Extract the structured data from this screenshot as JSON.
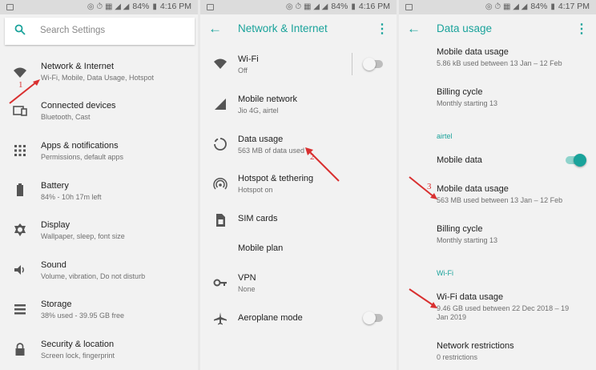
{
  "status": {
    "p1_battery": "84%",
    "p1_time": "4:16 PM",
    "p2_battery": "84%",
    "p2_time": "4:16 PM",
    "p3_battery": "84%",
    "p3_time": "4:17 PM"
  },
  "panel1": {
    "search_placeholder": "Search Settings",
    "items": [
      {
        "title": "Network & Internet",
        "subtitle": "Wi-Fi, Mobile, Data Usage, Hotspot",
        "icon": "wifi-icon"
      },
      {
        "title": "Connected devices",
        "subtitle": "Bluetooth, Cast",
        "icon": "devices-icon"
      },
      {
        "title": "Apps & notifications",
        "subtitle": "Permissions, default apps",
        "icon": "apps-grid-icon"
      },
      {
        "title": "Battery",
        "subtitle": "84% - 10h 17m left",
        "icon": "battery-icon"
      },
      {
        "title": "Display",
        "subtitle": "Wallpaper, sleep, font size",
        "icon": "brightness-icon"
      },
      {
        "title": "Sound",
        "subtitle": "Volume, vibration, Do not disturb",
        "icon": "volume-icon"
      },
      {
        "title": "Storage",
        "subtitle": "38% used - 39.95 GB free",
        "icon": "storage-icon"
      },
      {
        "title": "Security & location",
        "subtitle": "Screen lock, fingerprint",
        "icon": "lock-icon"
      }
    ]
  },
  "panel2": {
    "title": "Network & Internet",
    "items": [
      {
        "title": "Wi-Fi",
        "subtitle": "Off",
        "icon": "wifi-icon"
      },
      {
        "title": "Mobile network",
        "subtitle": "Jio 4G, airtel",
        "icon": "signal-icon"
      },
      {
        "title": "Data usage",
        "subtitle": "563 MB of data used",
        "icon": "data-usage-icon"
      },
      {
        "title": "Hotspot & tethering",
        "subtitle": "Hotspot on",
        "icon": "hotspot-icon"
      },
      {
        "title": "SIM cards",
        "subtitle": "",
        "icon": "sim-card-icon"
      },
      {
        "title": "Mobile plan",
        "subtitle": "",
        "icon": ""
      },
      {
        "title": "VPN",
        "subtitle": "None",
        "icon": "vpn-key-icon"
      },
      {
        "title": "Aeroplane mode",
        "subtitle": "",
        "icon": "airplane-icon"
      }
    ]
  },
  "panel3": {
    "title": "Data usage",
    "items": [
      {
        "title": "Mobile data usage",
        "subtitle": "5.86 kB used between 13 Jan – 12 Feb"
      },
      {
        "title": "Billing cycle",
        "subtitle": "Monthly starting 13"
      },
      {
        "section": "airtel"
      },
      {
        "title": "Mobile data",
        "subtitle": ""
      },
      {
        "title": "Mobile data usage",
        "subtitle": "563 MB used between 13 Jan – 12 Feb"
      },
      {
        "title": "Billing cycle",
        "subtitle": "Monthly starting 13"
      },
      {
        "section": "Wi-Fi"
      },
      {
        "title": "Wi-Fi data usage",
        "subtitle": "9.46 GB used between 22 Dec 2018 – 19",
        "subtitle2": "Jan 2019"
      },
      {
        "title": "Network restrictions",
        "subtitle": "0 restrictions"
      }
    ]
  },
  "annotations": {
    "a1": "1",
    "a2": "2",
    "a3": "3"
  },
  "colors": {
    "accent": "#1aa39b",
    "annotation": "#d93030"
  }
}
